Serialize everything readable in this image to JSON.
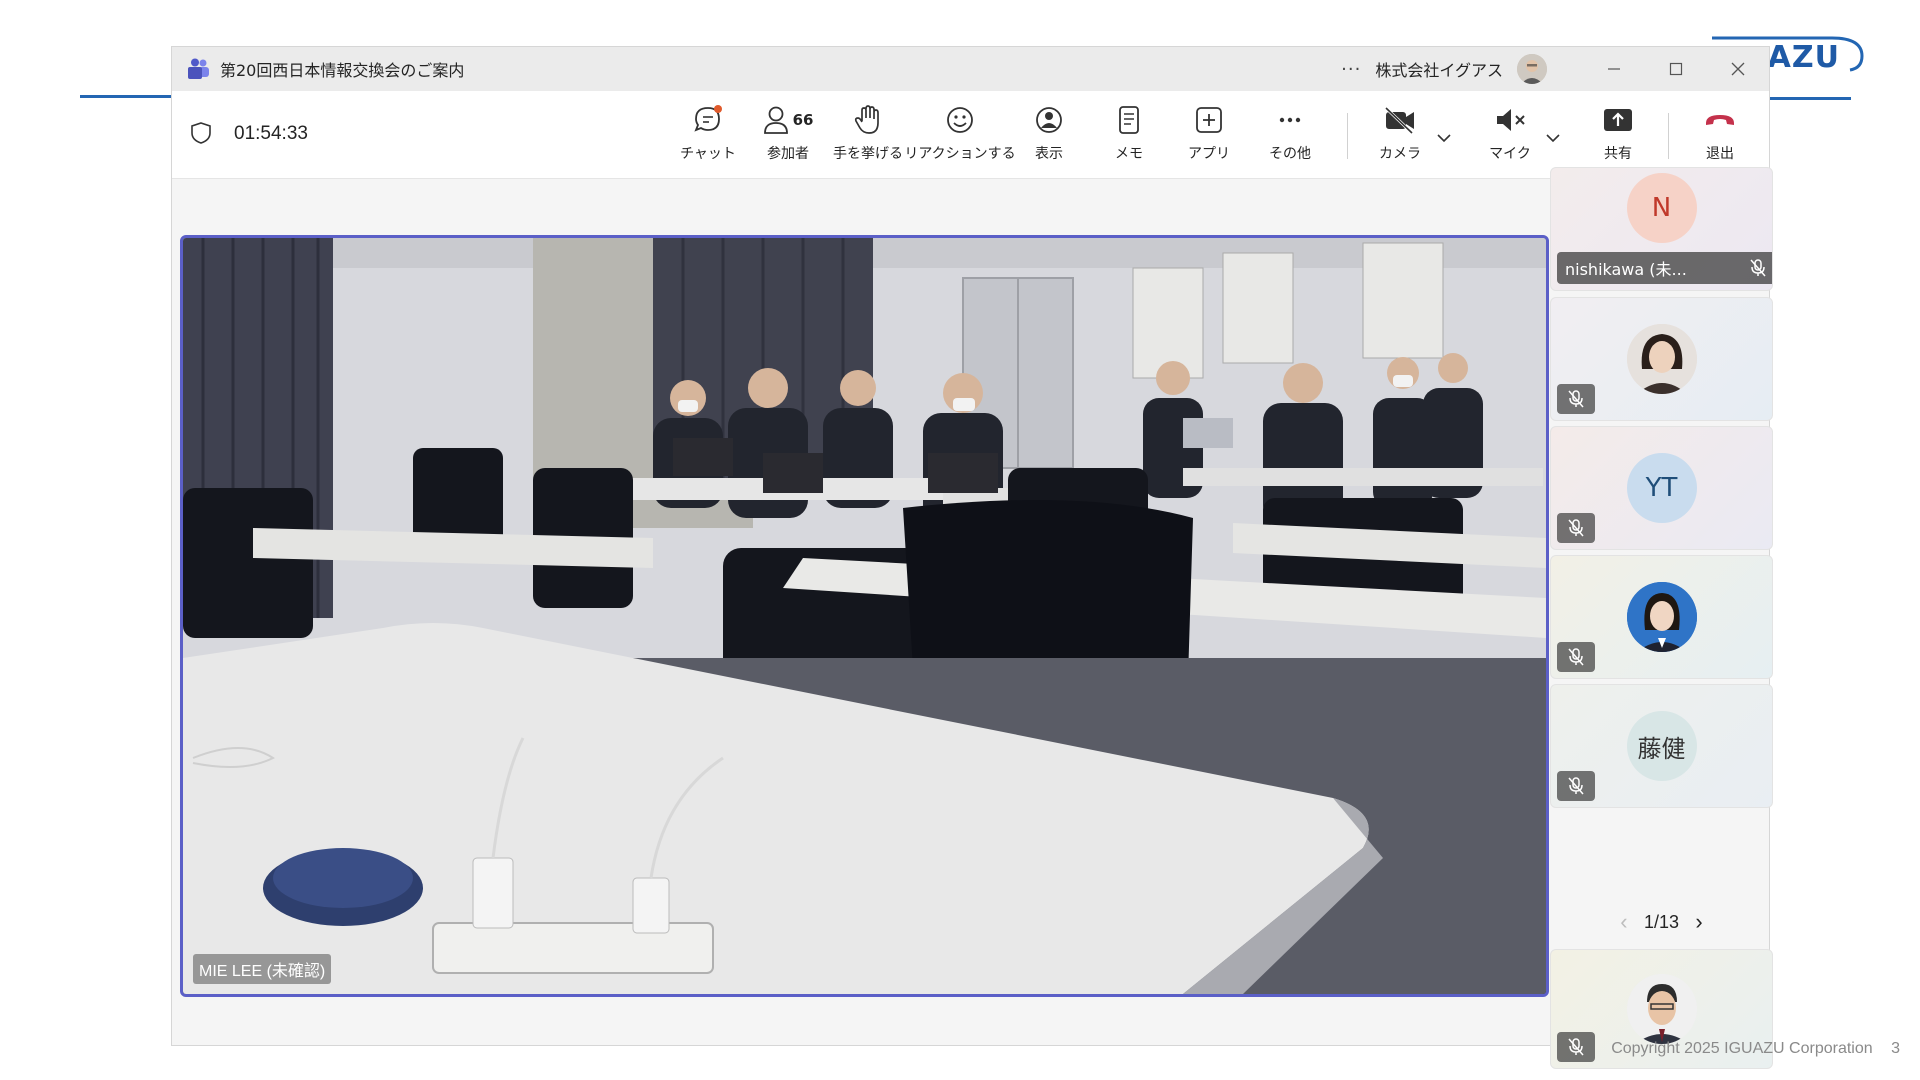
{
  "slide": {
    "logo_text": "AZU",
    "copyright": "Copyright 2025 IGUAZU Corporation",
    "page_number": "3",
    "rule_color": "#2366b3"
  },
  "window": {
    "title": "第20回西日本情報交換会のご案内",
    "more_menu": "···",
    "organization": "株式会社イグアス",
    "app_icon": "teams-icon"
  },
  "meeting": {
    "elapsed_time": "01:54:33",
    "participant_count": "66",
    "toolbar": {
      "chat": "チャット",
      "participants": "参加者",
      "raise_hand": "手を挙げる",
      "reactions": "リアクションする",
      "view": "表示",
      "notes": "メモ",
      "apps": "アプリ",
      "more": "その他",
      "camera": "カメラ",
      "mic": "マイク",
      "share": "共有",
      "leave": "退出"
    },
    "accent_color": "#5b5fc7",
    "leave_color": "#c4314b"
  },
  "stage": {
    "speaker_name": "MIE LEE (未確認)"
  },
  "participants": [
    {
      "initials": "N",
      "name": "nishikawa (未...",
      "muted": true,
      "kind": "initials",
      "avatar_bg": "#f6d2c7",
      "text_color": "#c0392b"
    },
    {
      "initials": "",
      "name": "",
      "muted": true,
      "kind": "photo-woman",
      "avatar_bg": "#e9e2dc",
      "text_color": "#333"
    },
    {
      "initials": "YT",
      "name": "",
      "muted": true,
      "kind": "initials",
      "avatar_bg": "#c9dcee",
      "text_color": "#1f4e79"
    },
    {
      "initials": "",
      "name": "",
      "muted": true,
      "kind": "photo-girl",
      "avatar_bg": "#2c6fc2",
      "text_color": "#333"
    },
    {
      "initials": "藤健",
      "name": "",
      "muted": true,
      "kind": "initials",
      "avatar_bg": "#d8e6e6",
      "text_color": "#333"
    },
    {
      "initials": "",
      "name": "",
      "muted": true,
      "kind": "photo-man",
      "avatar_bg": "#eaeaea",
      "text_color": "#333"
    }
  ],
  "pager": {
    "label": "1/13",
    "prev": "‹",
    "next": "›"
  }
}
